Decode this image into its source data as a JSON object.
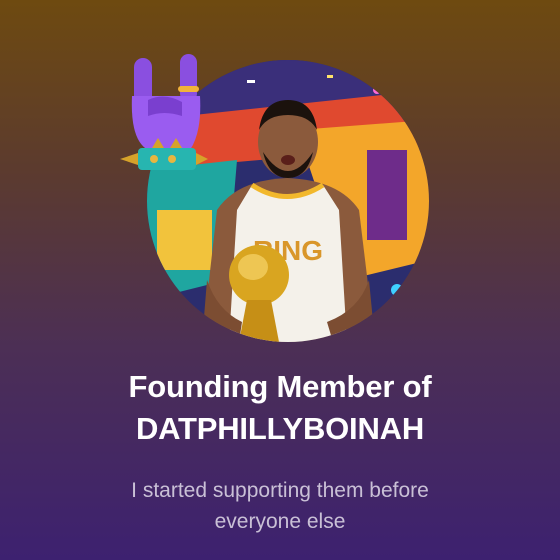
{
  "badge": {
    "title_line1": "Founding Member of",
    "title_line2": "DATPHILLYBOINAH",
    "description_line1": "I started supporting them before",
    "description_line2": "everyone else"
  },
  "icons": {
    "hand": "rock-on-hand-icon"
  },
  "colors": {
    "text_primary": "#ffffff",
    "text_secondary": "#c9c0d6",
    "background_top": "#6e4a10",
    "background_bottom": "#3d2170"
  }
}
